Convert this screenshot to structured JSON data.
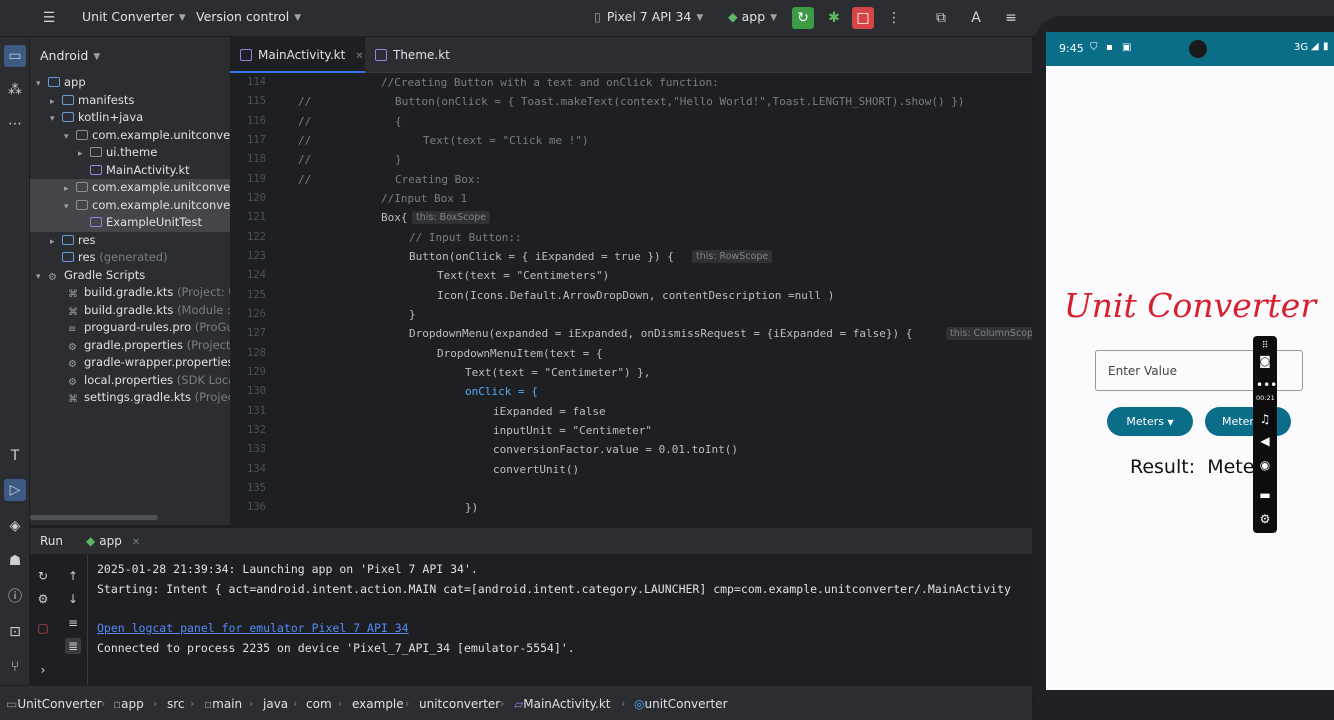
{
  "toolbar": {
    "project": "Unit Converter",
    "vcs": "Version control",
    "device": "Pixel 7 API 34",
    "run_config": "app",
    "icons": [
      "hamburger-icon",
      "rerun-icon",
      "debug-icon",
      "stop-icon",
      "more-icon",
      "device-manager-icon",
      "translate-icon",
      "settings-icon"
    ]
  },
  "project_panel": {
    "title": "Android",
    "tree": [
      {
        "label": "app",
        "extra": ""
      },
      {
        "label": "manifests",
        "extra": ""
      },
      {
        "label": "kotlin+java",
        "extra": ""
      },
      {
        "label": "com.example.unitconver",
        "extra": ""
      },
      {
        "label": "ui.theme",
        "extra": ""
      },
      {
        "label": "MainActivity.kt",
        "extra": ""
      },
      {
        "label": "com.example.unitconver",
        "extra": ""
      },
      {
        "label": "com.example.unitconver",
        "extra": ""
      },
      {
        "label": "ExampleUnitTest",
        "extra": ""
      },
      {
        "label": "res",
        "extra": ""
      },
      {
        "label": "res",
        "extra": "(generated)"
      },
      {
        "label": "Gradle Scripts",
        "extra": ""
      },
      {
        "label": "build.gradle.kts",
        "extra": "(Project: U"
      },
      {
        "label": "build.gradle.kts",
        "extra": "(Module :ap"
      },
      {
        "label": "proguard-rules.pro",
        "extra": "(ProGu"
      },
      {
        "label": "gradle.properties",
        "extra": "(Project P"
      },
      {
        "label": "gradle-wrapper.properties",
        "extra": ""
      },
      {
        "label": "local.properties",
        "extra": "(SDK Loca"
      },
      {
        "label": "settings.gradle.kts",
        "extra": "(Project"
      }
    ]
  },
  "editor": {
    "tabs": [
      "MainActivity.kt",
      "Theme.kt"
    ],
    "lines": [
      {
        "n": "114",
        "c": "//",
        "code": "//Creating Button with a text and onClick function:"
      },
      {
        "n": "115",
        "c": "//",
        "code": "Button(onClick = { Toast.makeText(context,\"Hello World!\",Toast.LENGTH_SHORT).show() })"
      },
      {
        "n": "116",
        "c": "//",
        "code": "{"
      },
      {
        "n": "117",
        "c": "//",
        "code": "Text(text = \"Click me !\")"
      },
      {
        "n": "118",
        "c": "//",
        "code": "}"
      },
      {
        "n": "119",
        "c": "//",
        "code": "Creating Box:"
      },
      {
        "n": "120",
        "c": "",
        "code": "//Input Box 1"
      },
      {
        "n": "121",
        "c": "",
        "code": "Box{"
      },
      {
        "n": "122",
        "c": "",
        "code": "// Input Button::"
      },
      {
        "n": "123",
        "c": "",
        "code": "Button(onClick = { iExpanded = true }) {"
      },
      {
        "n": "124",
        "c": "",
        "code": "Text(text = \"Centimeters\")"
      },
      {
        "n": "125",
        "c": "",
        "code": "Icon(Icons.Default.ArrowDropDown, contentDescription =null )"
      },
      {
        "n": "126",
        "c": "",
        "code": "}"
      },
      {
        "n": "127",
        "c": "",
        "code": "DropdownMenu(expanded = iExpanded, onDismissRequest = {iExpanded = false}) {"
      },
      {
        "n": "128",
        "c": "",
        "code": "DropdownMenuItem(text = {"
      },
      {
        "n": "129",
        "c": "",
        "code": "Text(text = \"Centimeter\") },"
      },
      {
        "n": "130",
        "c": "",
        "code": "onClick = {"
      },
      {
        "n": "131",
        "c": "",
        "code": "iExpanded = false"
      },
      {
        "n": "132",
        "c": "",
        "code": "inputUnit = \"Centimeter\""
      },
      {
        "n": "133",
        "c": "",
        "code": "conversionFactor.value = 0.01.toInt()"
      },
      {
        "n": "134",
        "c": "",
        "code": "convertUnit()"
      },
      {
        "n": "135",
        "c": "",
        "code": ""
      },
      {
        "n": "136",
        "c": "",
        "code": "})"
      }
    ],
    "hints": [
      "this: BoxScope",
      "this: RowScope",
      "this: ColumnScope"
    ]
  },
  "run_panel": {
    "tab_run": "Run",
    "tab_app": "app",
    "console": [
      "2025-01-28 21:39:34: Launching app on 'Pixel 7 API 34'.",
      "Starting: Intent { act=android.intent.action.MAIN cat=[android.intent.category.LAUNCHER] cmp=com.example.unitconverter/.MainActivity",
      "",
      "Open logcat panel for emulator Pixel 7 API 34",
      "Connected to process 2235 on device 'Pixel_7_API_34 [emulator-5554]'."
    ]
  },
  "status_bar": {
    "breadcrumbs": [
      "UnitConverter",
      "app",
      "src",
      "main",
      "java",
      "com",
      "example",
      "unitconverter",
      "MainActivity.kt",
      "unitConverter"
    ]
  },
  "emulator": {
    "time": "9:45",
    "network": "3G",
    "app_title": "Unit Converter",
    "input_placeholder": "Enter Value",
    "button_input_unit": "Meters",
    "button_output_unit": "Meters",
    "result_label": "Result:",
    "result_value": "Meters",
    "recording_time": "00:21",
    "accent_color": "#0b6e88",
    "title_color": "#d7202f"
  }
}
